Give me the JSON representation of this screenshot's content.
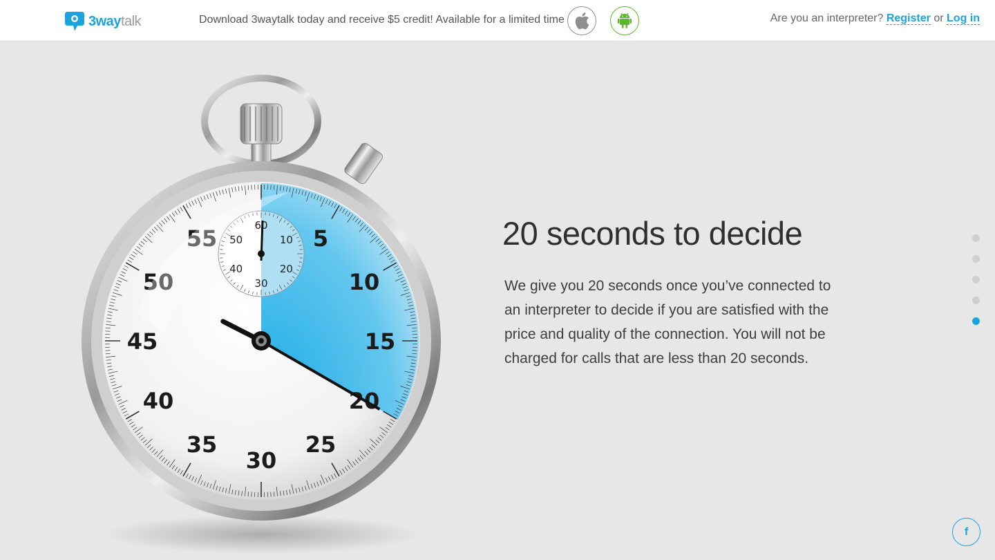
{
  "header": {
    "logo": {
      "brand_bold": "3way",
      "brand_light": "talk"
    },
    "promo_text": "Download 3waytalk today and receive $5 credit! Available for a limited time",
    "stores": [
      {
        "icon": "apple-icon"
      },
      {
        "icon": "android-icon"
      }
    ],
    "auth": {
      "question": "Are you an interpreter?",
      "register_label": "Register",
      "or_text": "or",
      "login_label": "Log in"
    }
  },
  "slide": {
    "title": "20 seconds to decide",
    "body": "We give you 20 seconds once you’ve connected to an interpreter to decide if you are satisfied with the price and quality of the connection. You will not be charged for calls that are less than 20 seconds."
  },
  "stopwatch": {
    "main_numbers": [
      "5",
      "10",
      "15",
      "20",
      "25",
      "30",
      "35",
      "40",
      "45",
      "50",
      "55"
    ],
    "sub_dial_numbers": [
      "60",
      "10",
      "20",
      "30",
      "40",
      "50"
    ],
    "highlight_seconds": 20,
    "accent_color": "#1aa3dc"
  },
  "pager": {
    "count": 5,
    "active_index": 4
  },
  "social": {
    "icon": "facebook-icon",
    "label": "f"
  },
  "colors": {
    "accent": "#1aa3dc",
    "android_green": "#5cb82a",
    "background": "#e7e7e7"
  }
}
